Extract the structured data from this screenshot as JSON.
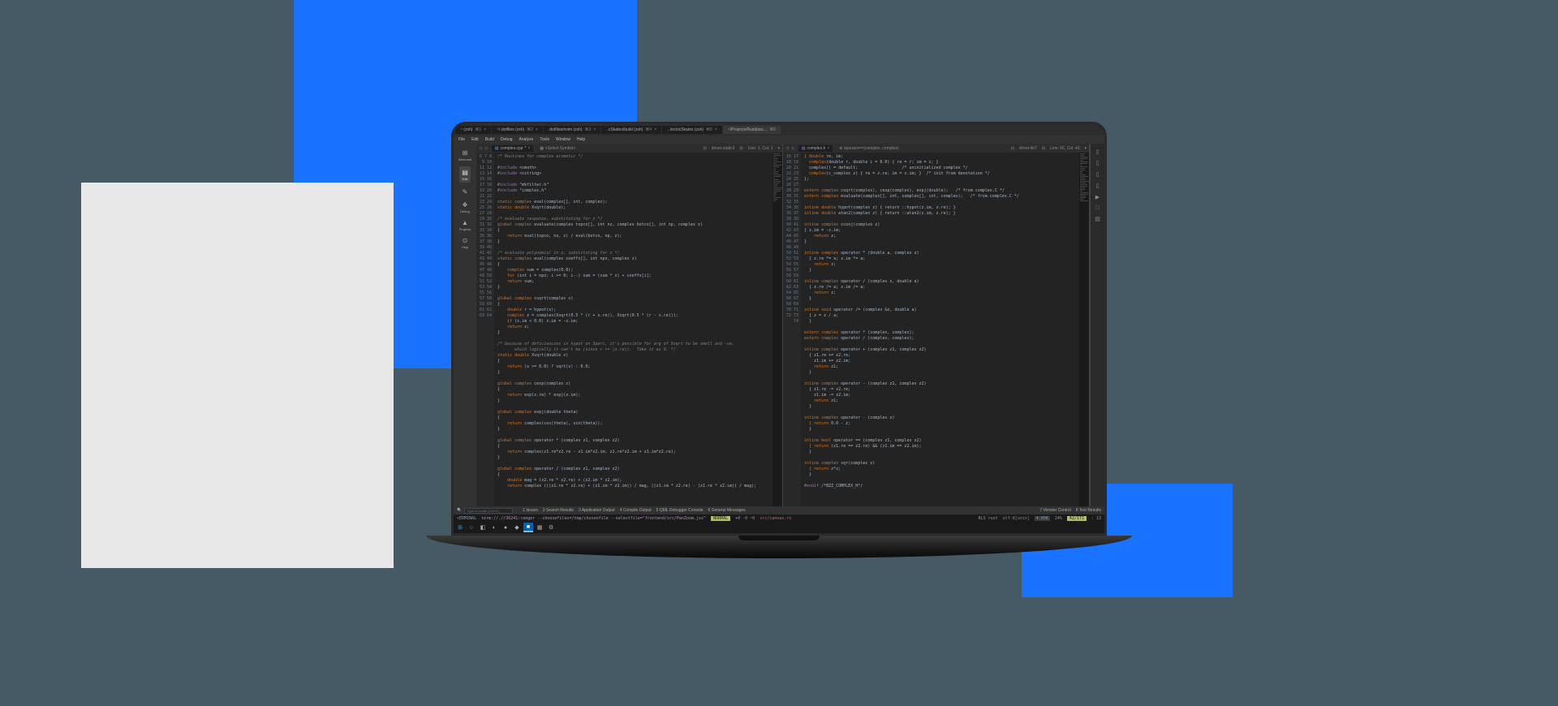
{
  "top_tabs": [
    {
      "label": "~ (zsh)",
      "key": "⌘1"
    },
    {
      "label": "~/.dotfiles (zsh)",
      "key": "⌘2"
    },
    {
      "label": ".dotfiles/nvim (zsh)",
      "key": "⌘3"
    },
    {
      "label": "..cSkates/build (zsh)",
      "key": "⌘4"
    },
    {
      "label": "...lectricSkates (zsh)",
      "key": "⌘5"
    },
    {
      "label": "~/Projects/Rust/pisc...",
      "key": "⌘6",
      "active": true
    }
  ],
  "menubar": [
    "File",
    "Edit",
    "Build",
    "Debug",
    "Analyze",
    "Tools",
    "Window",
    "Help"
  ],
  "sidebar": [
    {
      "icon": "⊞",
      "label": "Welcome"
    },
    {
      "icon": "▤",
      "label": "Edit",
      "active": true
    },
    {
      "icon": "✎",
      "label": ""
    },
    {
      "icon": "❖",
      "label": "Debug"
    },
    {
      "icon": "▲",
      "label": "Projects"
    },
    {
      "icon": "⊙",
      "label": "Help"
    }
  ],
  "secondary_sidebar": [
    "▯",
    "▯",
    "▯",
    "▯",
    "▶",
    "□",
    "▤"
  ],
  "left_editor": {
    "tabs": [
      {
        "label": "complex.cpp",
        "active": true
      }
    ],
    "symbol": "<Select Symbol>",
    "right_info": "driver-static3",
    "pos": "Line: 1, Col: 1",
    "line_start": 6,
    "lines": [
      {
        "t": "/* Routines for complex arimetic */",
        "cls": "c-cmt"
      },
      {
        "t": "",
        "cls": ""
      },
      {
        "t": "#include",
        "cls": "c-pre",
        "rest": " <cmath>"
      },
      {
        "t": "#include",
        "cls": "c-pre",
        "rest": " <cstring>"
      },
      {
        "t": "",
        "cls": ""
      },
      {
        "t": "#include",
        "cls": "c-pre",
        "rest": " \"mkfilter.h\""
      },
      {
        "t": "#include",
        "cls": "c-pre",
        "rest": " \"complex.h\""
      },
      {
        "t": "",
        "cls": ""
      },
      {
        "t": "static complex",
        "cls": "c-key",
        "rest": " eval(complex[], int, complex);"
      },
      {
        "t": "static double",
        "cls": "c-key",
        "rest": " Xsqrt(double);"
      },
      {
        "t": "",
        "cls": ""
      },
      {
        "t": "/* evaluate response, substituting for z */",
        "cls": "c-cmt"
      },
      {
        "t": "global complex",
        "cls": "c-key",
        "rest": " evaluate(complex topco[], int nz, complex botco[], int np, complex z)"
      },
      {
        "t": "{",
        "cls": ""
      },
      {
        "t": "    return",
        "cls": "c-key",
        "rest": " eval(topco, nz, z) / eval(botco, np, z);"
      },
      {
        "t": "}",
        "cls": ""
      },
      {
        "t": "",
        "cls": ""
      },
      {
        "t": "/* evaluate polynomial in z, substituting for z */",
        "cls": "c-cmt"
      },
      {
        "t": "static complex",
        "cls": "c-key",
        "rest": " eval(complex coeffs[], int npz, complex z)"
      },
      {
        "t": "{",
        "cls": ""
      },
      {
        "t": "    complex",
        "cls": "c-type",
        "rest": " sum = complex(0.0);"
      },
      {
        "t": "    for",
        "cls": "c-key",
        "rest": " (int i = npz; i >= 0; i--) sum = (sum * z) + coeffs[i];"
      },
      {
        "t": "    return",
        "cls": "c-key",
        "rest": " sum;"
      },
      {
        "t": "}",
        "cls": ""
      },
      {
        "t": "",
        "cls": ""
      },
      {
        "t": "global complex",
        "cls": "c-key",
        "rest": " csqrt(complex x)"
      },
      {
        "t": "{",
        "cls": ""
      },
      {
        "t": "    double",
        "cls": "c-type",
        "rest": " r = hypot(x);"
      },
      {
        "t": "    complex",
        "cls": "c-type",
        "rest": " z = complex(Xsqrt(0.5 * (r + x.re)), Xsqrt(0.5 * (r - x.re)));"
      },
      {
        "t": "    if",
        "cls": "c-key",
        "rest": " (x.im < 0.0) z.im = -z.im;"
      },
      {
        "t": "    return",
        "cls": "c-key",
        "rest": " z;"
      },
      {
        "t": "}",
        "cls": ""
      },
      {
        "t": "",
        "cls": ""
      },
      {
        "t": "/* because of deficiencies in hypot on Sparc, it's possible for arg of Xsqrt to be small and -ve,",
        "cls": "c-cmt"
      },
      {
        "t": "       which logically it can't be (since r >= |x.re|).  Take it as 0. */",
        "cls": "c-cmt"
      },
      {
        "t": "static double",
        "cls": "c-key",
        "rest": " Xsqrt(double x)"
      },
      {
        "t": "{",
        "cls": ""
      },
      {
        "t": "    return",
        "cls": "c-key",
        "rest": " (x >= 0.0) ? sqrt(x) : 0.0;"
      },
      {
        "t": "}",
        "cls": ""
      },
      {
        "t": "",
        "cls": ""
      },
      {
        "t": "global complex",
        "cls": "c-key",
        "rest": " cexp(complex z)"
      },
      {
        "t": "{",
        "cls": ""
      },
      {
        "t": "    return",
        "cls": "c-key",
        "rest": " exp(z.re) * expj(z.im);"
      },
      {
        "t": "}",
        "cls": ""
      },
      {
        "t": "",
        "cls": ""
      },
      {
        "t": "global complex",
        "cls": "c-key",
        "rest": " expj(double theta)"
      },
      {
        "t": "{",
        "cls": ""
      },
      {
        "t": "    return",
        "cls": "c-key",
        "rest": " complex(cos(theta), sin(theta));"
      },
      {
        "t": "}",
        "cls": ""
      },
      {
        "t": "",
        "cls": ""
      },
      {
        "t": "global complex",
        "cls": "c-key",
        "rest": " operator * (complex z1, complex z2)"
      },
      {
        "t": "{",
        "cls": ""
      },
      {
        "t": "    return",
        "cls": "c-key",
        "rest": " complex(z1.re*z2.re - z1.im*z2.im, z1.re*z2.im + z1.im*z2.re);"
      },
      {
        "t": "}",
        "cls": ""
      },
      {
        "t": "",
        "cls": ""
      },
      {
        "t": "global complex",
        "cls": "c-key",
        "rest": " operator / (complex z1, complex z2)"
      },
      {
        "t": "{",
        "cls": ""
      },
      {
        "t": "    double",
        "cls": "c-type",
        "rest": " mag = (z2.re * z2.re) + (z2.im * z2.im);"
      },
      {
        "t": "    return",
        "cls": "c-key",
        "rest": " complex (((z1.re * z2.re) + (z1.im * z2.im)) / mag, ((z1.im * z2.re) - (z1.re * z2.im)) / mag);"
      }
    ]
  },
  "right_editor": {
    "tabs": [
      {
        "label": "complex.h",
        "active": true
      }
    ],
    "symbol": "operator==(complex, complex)",
    "right_info": "driver-lib7",
    "pos": "Line: 66, Col: 40",
    "line_start": 16,
    "lines": [
      {
        "t": "{ double",
        "cls": "c-type",
        "rest": " re, im;"
      },
      {
        "t": "  complex",
        "cls": "c-type",
        "rest": "(double r, double i = 0.0) { re = r; im = i; }"
      },
      {
        "t": "  complex() = default;",
        "cls": "c-id",
        "rest": "                  /* uninitialized complex */"
      },
      {
        "t": "  complex",
        "cls": "c-type",
        "rest": "(c_complex z) { re = z.re; im = z.im; }  /* init from denotation */"
      },
      {
        "t": "};",
        "cls": ""
      },
      {
        "t": "",
        "cls": ""
      },
      {
        "t": "extern complex",
        "cls": "c-key",
        "rest": " csqrt(complex), cexp(complex), expj(double);   /* from complex.C */"
      },
      {
        "t": "extern complex",
        "cls": "c-key",
        "rest": " evaluate(complex[], int, complex[], int, complex);   /* from complex.C */"
      },
      {
        "t": "",
        "cls": ""
      },
      {
        "t": "inline double",
        "cls": "c-key",
        "rest": " hypot(complex z) { return ::hypot(z.im, z.re); }"
      },
      {
        "t": "inline double",
        "cls": "c-key",
        "rest": " atan2(complex z) { return ::atan2(z.im, z.re); }"
      },
      {
        "t": "",
        "cls": ""
      },
      {
        "t": "inline complex",
        "cls": "c-key",
        "rest": " cconj(complex z)"
      },
      {
        "t": "{ z.im = -z.im;",
        "cls": ""
      },
      {
        "t": "    return",
        "cls": "c-key",
        "rest": " z;"
      },
      {
        "t": "}",
        "cls": ""
      },
      {
        "t": "",
        "cls": ""
      },
      {
        "t": "inline complex",
        "cls": "c-key",
        "rest": " operator * (double a, complex z)"
      },
      {
        "t": "  { z.re *= a; z.im *= a;",
        "cls": ""
      },
      {
        "t": "    return",
        "cls": "c-key",
        "rest": " z;"
      },
      {
        "t": "  }",
        "cls": ""
      },
      {
        "t": "",
        "cls": ""
      },
      {
        "t": "inline complex",
        "cls": "c-key",
        "rest": " operator / (complex z, double a)"
      },
      {
        "t": "  { z.re /= a; z.im /= a;",
        "cls": ""
      },
      {
        "t": "    return",
        "cls": "c-key",
        "rest": " z;"
      },
      {
        "t": "  }",
        "cls": ""
      },
      {
        "t": "",
        "cls": ""
      },
      {
        "t": "inline void",
        "cls": "c-key",
        "rest": " operator /= (complex &z, double a)"
      },
      {
        "t": "  { z = z / a;",
        "cls": ""
      },
      {
        "t": "  }",
        "cls": ""
      },
      {
        "t": "",
        "cls": ""
      },
      {
        "t": "extern complex",
        "cls": "c-key",
        "rest": " operator * (complex, complex);"
      },
      {
        "t": "extern complex",
        "cls": "c-key",
        "rest": " operator / (complex, complex);"
      },
      {
        "t": "",
        "cls": ""
      },
      {
        "t": "inline complex",
        "cls": "c-key",
        "rest": " operator + (complex z1, complex z2)"
      },
      {
        "t": "  { z1.re += z2.re;",
        "cls": ""
      },
      {
        "t": "    z1.im += z2.im;",
        "cls": ""
      },
      {
        "t": "    return",
        "cls": "c-key",
        "rest": " z1;"
      },
      {
        "t": "  }",
        "cls": ""
      },
      {
        "t": "",
        "cls": ""
      },
      {
        "t": "inline complex",
        "cls": "c-key",
        "rest": " operator - (complex z1, complex z2)"
      },
      {
        "t": "  { z1.re -= z2.re;",
        "cls": ""
      },
      {
        "t": "    z1.im -= z2.im;",
        "cls": ""
      },
      {
        "t": "    return",
        "cls": "c-key",
        "rest": " z1;"
      },
      {
        "t": "  }",
        "cls": ""
      },
      {
        "t": "",
        "cls": ""
      },
      {
        "t": "inline complex",
        "cls": "c-key",
        "rest": " operator - (complex z)"
      },
      {
        "t": "  { return",
        "cls": "c-key",
        "rest": " 0.0 - z;"
      },
      {
        "t": "  }",
        "cls": ""
      },
      {
        "t": "",
        "cls": ""
      },
      {
        "t": "inline bool",
        "cls": "c-key",
        "rest": " operator == (complex z1, complex z2)"
      },
      {
        "t": "  { return",
        "cls": "c-key",
        "rest": " (z1.re == z2.re) && (z1.im == z2.im);"
      },
      {
        "t": "  }",
        "cls": ""
      },
      {
        "t": "",
        "cls": ""
      },
      {
        "t": "inline complex",
        "cls": "c-key",
        "rest": " sqr(complex z)"
      },
      {
        "t": "  { return",
        "cls": "c-key",
        "rest": " z*z;"
      },
      {
        "t": "  }",
        "cls": ""
      },
      {
        "t": "",
        "cls": ""
      },
      {
        "t": "#endif",
        "cls": "c-pre",
        "rest": " /*BZZ_COMPLEX_H*/"
      }
    ]
  },
  "bottom_panel": {
    "search_placeholder": "Type to locate (Ctrl+K)",
    "items": [
      "1  Issues",
      "2  Search Results",
      "3  Application Output",
      "4  Compile Output",
      "5  QML Debugger Console",
      "6  General Messages"
    ],
    "right": [
      "7  Version Control",
      "8  Test Results"
    ]
  },
  "statusbar": {
    "left": "<ERMINAL",
    "term": "term://.//36241:ranger  --choosefiles=/tmp/chosenfile --selectfile=\"frontend/src/PanZoom.jsx\"",
    "mode": "NORMAL",
    "pos": "+0 -0 ~0",
    "file": "src/canvas.rs",
    "lang": "RLS  rust",
    "enc": "utf-8[unix]",
    "size": "4.05K",
    "perc": "24%",
    "line": "42/171",
    "col": ": 13"
  },
  "taskbar": [
    "⊞",
    "○",
    "◧",
    "◐",
    "●",
    "◆",
    "■",
    "▦",
    "⚙"
  ]
}
